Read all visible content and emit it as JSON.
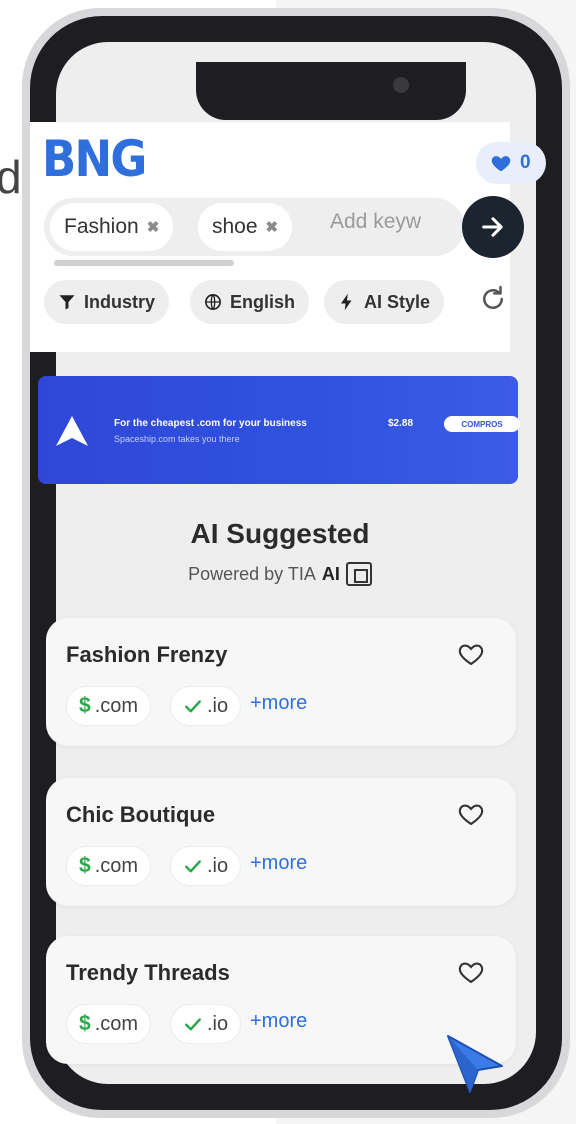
{
  "side_text": "d",
  "app": {
    "logo": "BNG",
    "favorites_count": "0"
  },
  "search": {
    "chips": [
      {
        "label": "Fashion"
      },
      {
        "label": "shoe"
      }
    ],
    "placeholder": "Add keyw"
  },
  "filters": [
    {
      "label": "Industry",
      "icon": "filter-icon"
    },
    {
      "label": "English",
      "icon": "globe-icon"
    },
    {
      "label": "AI Style",
      "icon": "bolt-icon"
    }
  ],
  "banner": {
    "title": "For the cheapest .com for your business",
    "subtitle": "Spaceship.com takes you there",
    "price": "$2.88",
    "cta": "COMPROS"
  },
  "section": {
    "title": "AI Suggested",
    "powered_by": "Powered by TIA",
    "powered_brand": "AI"
  },
  "suggestions": [
    {
      "name": "Fashion Frenzy",
      "tlds": [
        ".com",
        ".io"
      ],
      "more": "+more"
    },
    {
      "name": "Chic Boutique",
      "tlds": [
        ".com",
        ".io"
      ],
      "more": "+more"
    },
    {
      "name": "Trendy Threads",
      "tlds": [
        ".com",
        ".io"
      ],
      "more": "+more"
    }
  ],
  "colors": {
    "accent": "#2f6fdb",
    "available": "#2aa84a",
    "banner": "#3152e0"
  }
}
